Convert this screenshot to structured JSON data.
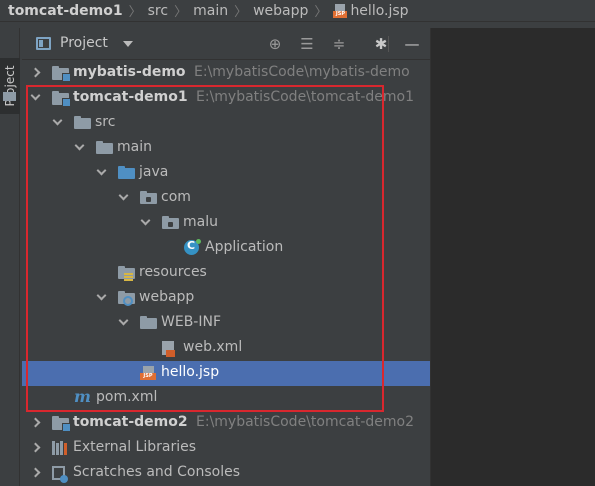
{
  "navbar": {
    "crumbs": [
      "tomcat-demo1",
      "src",
      "main",
      "webapp",
      "hello.jsp"
    ]
  },
  "stripe": {
    "tab_label": "Project"
  },
  "panel": {
    "title": "Project",
    "tools": [
      "globe-icon",
      "expand-all-icon",
      "collapse-all-icon",
      "gear-icon",
      "minimize-icon"
    ]
  },
  "tree": {
    "rows": [
      {
        "label": "mybatis-demo",
        "path": "E:\\mybatisCode\\mybatis-demo",
        "icon": "module-folder-icon",
        "depth": 0,
        "expanded": false,
        "bold": true
      },
      {
        "label": "tomcat-demo1",
        "path": "E:\\mybatisCode\\tomcat-demo1",
        "icon": "module-folder-icon",
        "depth": 0,
        "expanded": true,
        "bold": true
      },
      {
        "label": "src",
        "path": "",
        "icon": "folder-icon",
        "depth": 1,
        "expanded": true
      },
      {
        "label": "main",
        "path": "",
        "icon": "folder-icon",
        "depth": 2,
        "expanded": true
      },
      {
        "label": "java",
        "path": "",
        "icon": "source-folder-icon",
        "depth": 3,
        "expanded": true
      },
      {
        "label": "com",
        "path": "",
        "icon": "package-icon",
        "depth": 4,
        "expanded": true
      },
      {
        "label": "malu",
        "path": "",
        "icon": "package-icon",
        "depth": 5,
        "expanded": true
      },
      {
        "label": "Application",
        "path": "",
        "icon": "spring-class-icon",
        "depth": 6,
        "leaf": true
      },
      {
        "label": "resources",
        "path": "",
        "icon": "resources-folder-icon",
        "depth": 3,
        "leaf": true
      },
      {
        "label": "webapp",
        "path": "",
        "icon": "web-folder-icon",
        "depth": 3,
        "expanded": true
      },
      {
        "label": "WEB-INF",
        "path": "",
        "icon": "folder-icon",
        "depth": 4,
        "expanded": true
      },
      {
        "label": "web.xml",
        "path": "",
        "icon": "xml-file-icon",
        "depth": 5,
        "leaf": true
      },
      {
        "label": "hello.jsp",
        "path": "",
        "icon": "jsp-file-icon",
        "depth": 4,
        "leaf": true,
        "selected": true
      },
      {
        "label": "pom.xml",
        "path": "",
        "icon": "maven-icon",
        "depth": 1,
        "leaf": true
      },
      {
        "label": "tomcat-demo2",
        "path": "E:\\mybatisCode\\tomcat-demo2",
        "icon": "module-folder-icon",
        "depth": 0,
        "expanded": false,
        "bold": true
      },
      {
        "label": "External Libraries",
        "path": "",
        "icon": "libraries-icon",
        "depth": 0,
        "expanded": false
      },
      {
        "label": "Scratches and Consoles",
        "path": "",
        "icon": "scratches-icon",
        "depth": 0,
        "expanded": false
      }
    ]
  },
  "colors": {
    "background": "#3c3f41",
    "editor": "#2b2b2b",
    "selection": "#4b6eaf",
    "highlight_border": "#d9272e",
    "text": "#bbbbbb",
    "path_text": "#808080"
  }
}
